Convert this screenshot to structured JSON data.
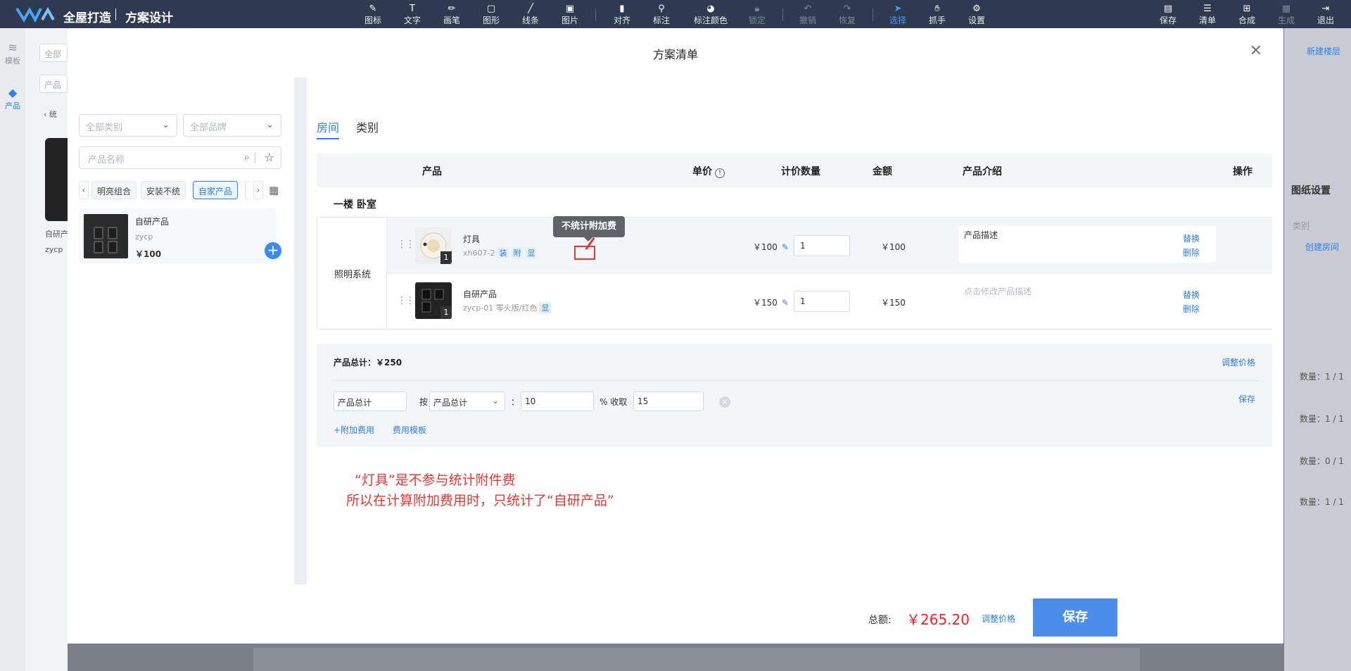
{
  "topbar": {
    "brand": "全屋打造",
    "page": "方案设计",
    "tools": [
      "图标",
      "文字",
      "画笔",
      "图形",
      "线条",
      "图片",
      "对齐",
      "标注",
      "标注颜色",
      "锁定",
      "撤销",
      "恢复",
      "选择",
      "抓手",
      "设置"
    ],
    "right_tools": [
      "保存",
      "清单",
      "合成",
      "生成",
      "退出"
    ]
  },
  "leftnav": {
    "items": [
      "模板",
      "产品"
    ]
  },
  "background": {
    "input1": "全部",
    "input2": "产品",
    "back": "统",
    "card_name": "自研产",
    "card_code": "zycp",
    "right_link1": "新建楼层",
    "right_title": "图纸设置",
    "right_cat": "类别",
    "right_create": "创建房间",
    "counts": [
      "数量：1 / 1",
      "数量：1 / 1",
      "数量：0 / 1",
      "数量：1 / 1"
    ]
  },
  "modal": {
    "title": "方案清单",
    "left": {
      "category_select": "全部类别",
      "brand_select": "全部品牌",
      "search_placeholder": "产品名称",
      "chips": [
        "明亮组合",
        "安装不统",
        "自家产品"
      ],
      "product": {
        "name": "自研产品",
        "code": "zycp",
        "price": "￥100"
      }
    },
    "tabs": [
      "房间",
      "类别"
    ],
    "table": {
      "headers": [
        "产品",
        "单价",
        "计价数量",
        "金额",
        "产品介绍",
        "操作"
      ],
      "room": "一楼 卧室",
      "category": "照明系统",
      "rows": [
        {
          "name": "灯具",
          "code": "xh607-2",
          "tags": [
            "装",
            "附",
            "显"
          ],
          "qty_badge": "1",
          "price": "￥100",
          "qty": "1",
          "amount": "￥100",
          "desc": "产品描述",
          "ops": [
            "替换",
            "删除"
          ]
        },
        {
          "name": "自研产品",
          "code": "zycp-01 零火版/红色",
          "tags": [
            "显"
          ],
          "qty_badge": "1",
          "price": "￥150",
          "qty": "1",
          "amount": "￥150",
          "desc": "点击修改产品描述",
          "ops": [
            "替换",
            "删除"
          ]
        }
      ],
      "tooltip": "不统计附加费"
    },
    "fee": {
      "total": "产品总计：￥250",
      "adjust": "调整价格",
      "name": "产品总计",
      "by": "按",
      "basis": "产品总计",
      "colon": "：",
      "percent": "10",
      "percent_label": "% 收取",
      "charge": "15",
      "save": "保存",
      "add": "+附加费用",
      "template": "费用模板"
    },
    "annotation": [
      "“灯具”是不参与统计附件费",
      "所以在计算附加费用时，只统计了“自研产品”"
    ],
    "footer": {
      "total_label": "总额:",
      "total_value": "￥265.20",
      "adjust": "调整价格",
      "save": "保存"
    }
  },
  "colors": {
    "accent": "#2f80ed",
    "topbar": "#2e3a4f",
    "price_red": "#f5222d",
    "annotation_red": "#e53935"
  }
}
